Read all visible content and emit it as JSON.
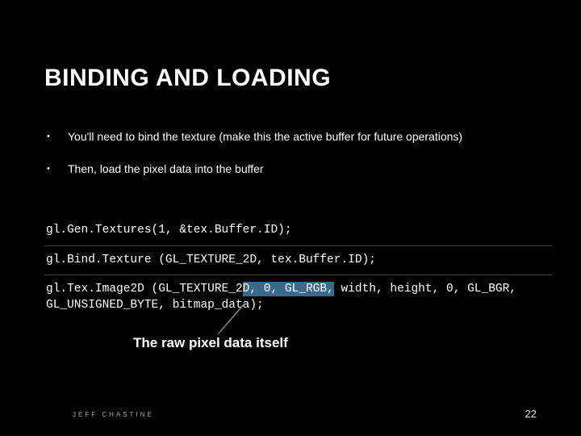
{
  "title": "BINDING AND LOADING",
  "bullets": [
    "You'll need to bind the texture (make this the active buffer for future operations)",
    "Then, load the pixel data into the buffer"
  ],
  "code": {
    "line1_pre": "gl.Gen.Textures(1, &tex.Buffer.ID);",
    "line2_pre": "gl.Bind.Texture (GL_TEXTURE_2D, tex.Buffer.ID);",
    "line3_pre": "gl.Tex.Image2D (GL_TEXTURE_2",
    "line3_hl": "D, 0, GL_RGB,",
    "line3_post": " width, height, 0, GL_BGR, GL_UNSIGNED_BYTE, ",
    "line3_arg": "bitmap_data",
    "line3_end": ");"
  },
  "annotation": "The raw pixel data itself",
  "footer": {
    "author": "JEFF CHASTINE",
    "page": "22"
  }
}
